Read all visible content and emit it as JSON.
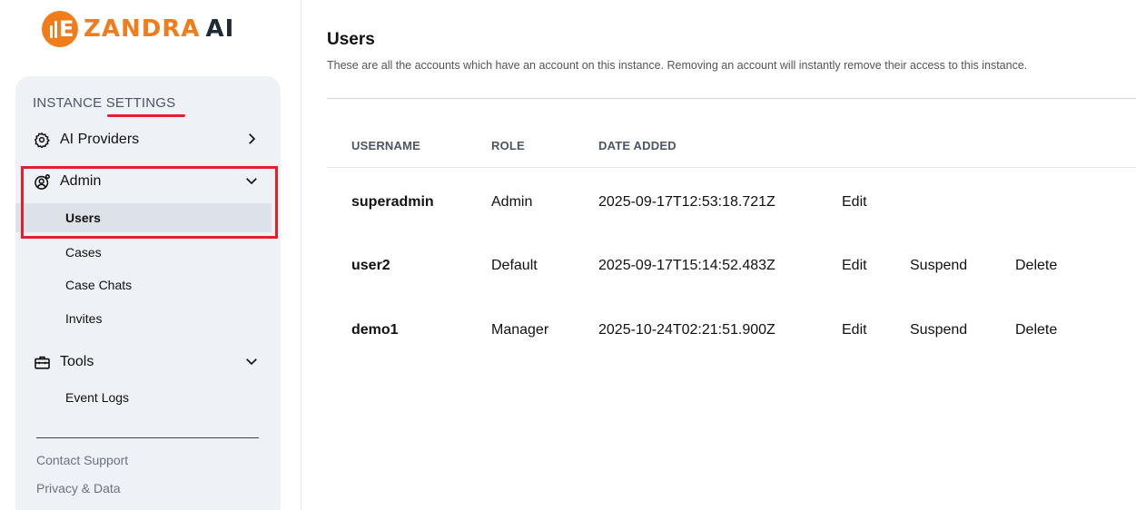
{
  "brand": {
    "logo_letter": "E",
    "name": "ZANDRA",
    "suffix": "AI"
  },
  "sidebar": {
    "section_title": "INSTANCE SETTINGS",
    "ai_providers_label": "AI Providers",
    "admin_label": "Admin",
    "admin_items": [
      "Users",
      "Cases",
      "Case Chats",
      "Invites"
    ],
    "tools_label": "Tools",
    "tools_items": [
      "Event Logs"
    ],
    "footer": [
      "Contact Support",
      "Privacy & Data"
    ]
  },
  "main": {
    "title": "Users",
    "description": "These are all the accounts which have an account on this instance. Removing an account will instantly remove their access to this instance.",
    "columns": [
      "USERNAME",
      "ROLE",
      "DATE ADDED"
    ],
    "rows": [
      {
        "username": "superadmin",
        "role": "Admin",
        "date": "2025-09-17T12:53:18.721Z",
        "actions": [
          "Edit"
        ]
      },
      {
        "username": "user2",
        "role": "Default",
        "date": "2025-09-17T15:14:52.483Z",
        "actions": [
          "Edit",
          "Suspend",
          "Delete"
        ]
      },
      {
        "username": "demo1",
        "role": "Manager",
        "date": "2025-10-24T02:21:51.900Z",
        "actions": [
          "Edit",
          "Suspend",
          "Delete"
        ]
      }
    ]
  },
  "colors": {
    "brand_orange": "#f07c1c",
    "highlight_red": "#e0202a",
    "panel_bg": "#eef1f6"
  }
}
